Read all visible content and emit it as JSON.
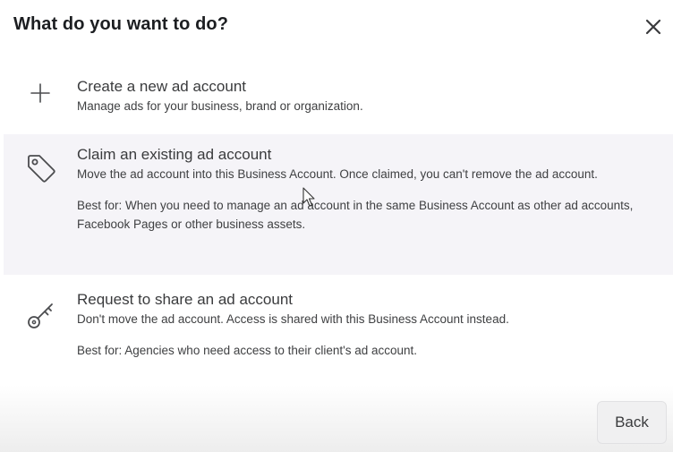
{
  "dialog": {
    "title": "What do you want to do?",
    "close_icon": "close-icon"
  },
  "options": [
    {
      "icon": "plus-icon",
      "title": "Create a new ad account",
      "description": "Manage ads for your business, brand or organization.",
      "best_for": ""
    },
    {
      "icon": "tag-icon",
      "title": "Claim an existing ad account",
      "description": "Move the ad account into this Business Account. Once claimed, you can't remove the ad account.",
      "best_for": "Best for: When you need to manage an ad account in the same Business Account as other ad accounts, Facebook Pages or other business assets.",
      "highlighted": true
    },
    {
      "icon": "key-icon",
      "title": "Request to share an ad account",
      "description": "Don't move the ad account. Access is shared with this Business Account instead.",
      "best_for": "Best for: Agencies who need access to their client's ad account."
    }
  ],
  "footer": {
    "back_label": "Back"
  },
  "colors": {
    "highlight_bg": "#f5f4f8",
    "text": "#3a3b3d",
    "button_bg": "#f0f0f1"
  }
}
